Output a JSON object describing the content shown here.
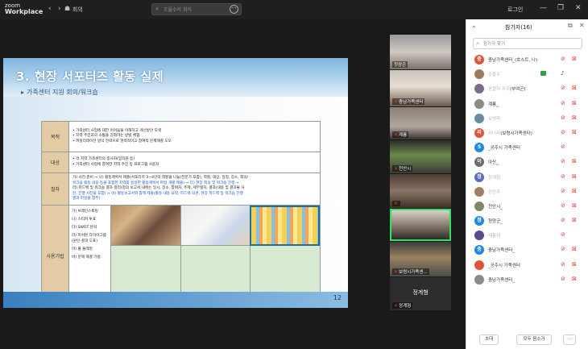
{
  "app": {
    "brand_line1": "zoom",
    "brand_line2": "Workplace",
    "meeting_label": "회의",
    "search_placeholder": "조율수의 회의",
    "login": "로그인"
  },
  "slide": {
    "title": "3. 현장 서포터즈 활동 실제",
    "subtitle": "가족센터 지원 회의/워크숍",
    "page": "12",
    "rows": [
      {
        "label": "목적",
        "lines": [
          "• 가족센터 사업에 대한 어려움을 이해하고 개선방안 모색",
          "• 지역 주민과의 소통을 강화하는 방법 체험",
          "• 퍼실리테이션 방식 전략으로 현력적이고 참여적 문제해결 도모"
        ]
      },
      {
        "label": "대상",
        "lines": [
          "• 각 지역 가족센터의 종사자(임직원 등)",
          "• 가족센터 사업에 참여한 지역 주민 등 프로그램 사용자"
        ]
      },
      {
        "label": "절차",
        "lines": [
          "가) 사전 준비 → 나) 활동계획서 제출(서포터즈 3~4인의 역할을 나눔(전문가 포함), 역할, 대상, 일정, 장소, 회의/",
          "워크숍 활동 내용 등을 포함한 지역맞 동일한 활동계획서 파일 개별 제출) → 다) 현장 회의 및 워크숍 진행 →",
          "라) 피드백 및 워크숍 결과 정리(정의 보고서 내에는 일시, 장소, 참여자, 주제, 세부절차, 결과(내용 및 결과물 사",
          "진, 진행 사진을 포함) → 마) 활동보고서와 함께 제출(활동 내용 요약, 피드백 의견, 현장 피드백 및 워크숍 진행",
          "결과 파일을 첨부)"
        ]
      }
    ],
    "method_label": "사용기법",
    "methods": [
      "가) 브레인스토밍",
      "나) 스티커 투표",
      "다) SWOT 분석",
      "라) 피쉬본 다이어그램\n(원인-결과 도표)",
      "마) 롤 플레잉",
      "바) 문제 해결 기법"
    ]
  },
  "videos": [
    {
      "name": "첫광은"
    },
    {
      "name": "충남가족센터"
    },
    {
      "name": "계룡"
    },
    {
      "name": "천안시"
    },
    {
      "name": ""
    },
    {
      "name": ""
    },
    {
      "name": "보령시가족센..."
    },
    {
      "name": "정계형",
      "center": "정계형"
    }
  ],
  "panel": {
    "title": "참가자(16)",
    "search_placeholder": "참가자 찾기",
    "participants": [
      {
        "avatar": "충",
        "color": "#e0533a",
        "name": "충남가족센터_",
        "blur": "",
        "suffix": "(호스트, 나)",
        "cam_off": true,
        "mic_on": false
      },
      {
        "avatar": "",
        "color": "#9c7b5e",
        "name": "",
        "blur": "조율수",
        "suffix": "",
        "cam_off": false,
        "mic_on": true,
        "badge": true
      },
      {
        "avatar": "",
        "color": "#7e6a8a",
        "name": "",
        "blur": "윤쌀자 자주",
        "suffix": "(부여군)",
        "cam_off": true,
        "mic_on": false
      },
      {
        "avatar": "",
        "color": "#8b8b8b",
        "name": "계룡_",
        "blur": "",
        "suffix": "",
        "cam_off": true,
        "mic_on": false
      },
      {
        "avatar": "",
        "color": "#6d8aa0",
        "name": "",
        "blur": "보령학",
        "suffix": "",
        "cam_off": true,
        "mic_on": false
      },
      {
        "avatar": "리",
        "color": "#e0533a",
        "name": "",
        "blur": "리나라",
        "suffix": "(보령시가족센터)",
        "cam_off": true,
        "mic_on": false
      },
      {
        "avatar": "S",
        "color": "#1e88e5",
        "name": "",
        "blur": "",
        "suffix": "_공주시 가족센터",
        "cam_off": false,
        "mic_on": false
      },
      {
        "avatar": "이",
        "color": "#6d6d6d",
        "name": "아산_",
        "blur": "",
        "suffix": "",
        "cam_off": true,
        "mic_on": false
      },
      {
        "avatar": "정",
        "color": "#5c6bc0",
        "name": "",
        "blur": "정계형",
        "suffix": "",
        "cam_off": true,
        "mic_on": false
      },
      {
        "avatar": "",
        "color": "#a07e6a",
        "name": "",
        "blur": "정양주",
        "suffix": "",
        "cam_off": true,
        "mic_on": false
      },
      {
        "avatar": "",
        "color": "#7d8a6a",
        "name": "천안시_",
        "blur": "",
        "suffix": "",
        "cam_off": true,
        "mic_on": false
      },
      {
        "avatar": "청",
        "color": "#1e88e5",
        "name": "청양군_",
        "blur": "",
        "suffix": "",
        "cam_off": true,
        "mic_on": false
      },
      {
        "avatar": "",
        "color": "#5d4a8a",
        "name": "",
        "blur": "재통재",
        "suffix": "",
        "cam_off": false,
        "mic_on": false
      },
      {
        "avatar": "충",
        "color": "#1e88e5",
        "name": "충남가족센터_",
        "blur": "",
        "suffix": "",
        "cam_off": true,
        "mic_on": false
      },
      {
        "avatar": "",
        "color": "#e0533a",
        "name": "",
        "blur": "",
        "suffix": "_공주시 가족센터",
        "cam_off": true,
        "mic_on": false
      },
      {
        "avatar": "",
        "color": "#8a8a8a",
        "name": "충남가족센터_",
        "blur": "",
        "suffix": "",
        "cam_off": true,
        "mic_on": false
      }
    ],
    "invite_label": "초대",
    "mute_all_label": "모두 음소거",
    "more_label": "···"
  }
}
